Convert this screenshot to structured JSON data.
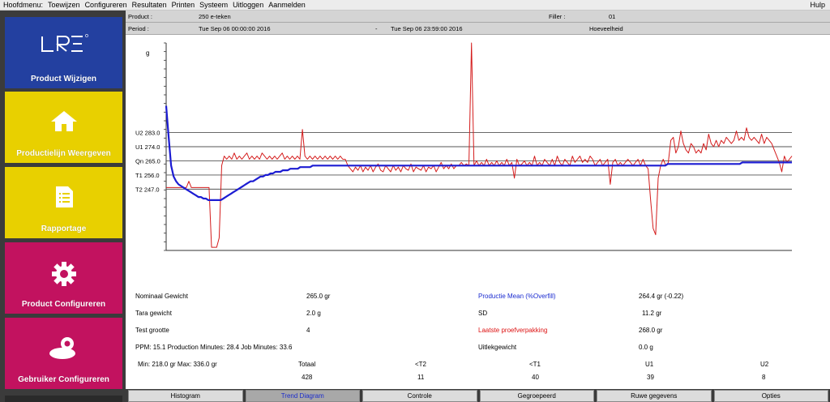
{
  "menu": {
    "items": [
      "Hoofdmenu:",
      "Toewijzen",
      "Configureren",
      "Resultaten",
      "Printen",
      "Systeem",
      "Uitloggen",
      "Aanmelden"
    ],
    "help": "Hulp"
  },
  "sidebar": {
    "logo_text": "LRE",
    "tiles": [
      {
        "label": "Product Wijzigen",
        "icon": "lre-logo",
        "color": "#2340a0"
      },
      {
        "label": "Productielijn Weergeven",
        "icon": "home-icon",
        "color": "#e8d000"
      },
      {
        "label": "Rapportage",
        "icon": "document-icon",
        "color": "#e8d000"
      },
      {
        "label": "Product Configureren",
        "icon": "gear-icon",
        "color": "#c2125f"
      },
      {
        "label": "Gebruiker Configureren",
        "icon": "user-gear-icon",
        "color": "#c2125f"
      }
    ]
  },
  "info": {
    "product_label": "Product :",
    "product_value": "250 e-teken",
    "filler_label": "Filler :",
    "filler_value": "01",
    "period_label": "Period :",
    "period_start": "Tue Sep 06 00:00:00 2016",
    "period_sep": "-",
    "period_end": "Tue Sep 06 23:59:00 2016",
    "quantity_label": "Hoeveelheid"
  },
  "chart_data": {
    "type": "line",
    "ylabel": "g",
    "ylim": [
      208,
      340
    ],
    "reference_lines": [
      {
        "label": "U2 283.0",
        "value": 283.0
      },
      {
        "label": "U1 274.0",
        "value": 274.0
      },
      {
        "label": "Qn 265.0",
        "value": 265.0
      },
      {
        "label": "T1 256.0",
        "value": 256.0
      },
      {
        "label": "T2 247.0",
        "value": 247.0
      }
    ],
    "series": [
      {
        "color": "#d41c1c",
        "values": [
          248,
          248,
          248,
          248,
          248,
          248,
          248,
          248,
          248,
          252,
          248,
          248,
          248,
          248,
          248,
          248,
          248,
          248,
          210,
          210,
          210,
          216,
          262,
          268,
          266,
          268,
          266,
          270,
          266,
          268,
          266,
          268,
          270,
          266,
          268,
          266,
          268,
          266,
          270,
          268,
          266,
          268,
          266,
          268,
          266,
          268,
          270,
          266,
          268,
          266,
          268,
          266,
          268,
          266,
          285,
          268,
          266,
          268,
          266,
          268,
          266,
          268,
          266,
          268,
          266,
          268,
          266,
          268,
          266,
          268,
          266,
          266,
          262,
          260,
          258,
          261,
          259,
          262,
          258,
          261,
          259,
          262,
          258,
          261,
          263,
          259,
          258,
          262,
          260,
          258,
          262,
          259,
          261,
          258,
          262,
          260,
          259,
          263,
          258,
          261,
          260,
          259,
          262,
          258,
          261,
          260,
          262,
          258,
          261,
          264,
          260,
          262,
          260,
          263,
          260,
          262,
          262,
          264,
          262,
          263,
          262,
          340,
          262,
          265,
          262,
          264,
          262,
          266,
          262,
          264,
          262,
          265,
          262,
          264,
          262,
          266,
          262,
          264,
          254,
          266,
          262,
          263,
          265,
          262,
          264,
          262,
          268,
          262,
          264,
          262,
          266,
          264,
          262,
          266,
          262,
          268,
          264,
          262,
          266,
          264,
          262,
          268,
          264,
          266,
          268,
          264,
          266,
          264,
          268,
          266,
          262,
          264,
          266,
          262,
          264,
          266,
          250,
          264,
          266,
          262,
          264,
          262,
          264,
          266,
          264,
          262,
          264,
          266,
          262,
          266,
          262,
          260,
          240,
          222,
          218,
          254,
          262,
          266,
          262,
          264,
          278,
          280,
          270,
          274,
          284,
          276,
          272,
          270,
          276,
          274,
          270,
          272,
          270,
          276,
          272,
          282,
          276,
          274,
          278,
          274,
          278,
          276,
          280,
          278,
          276,
          278,
          284,
          278,
          280,
          278,
          286,
          280,
          278,
          280,
          278,
          276,
          282,
          276,
          280,
          278,
          276,
          272,
          268,
          264,
          258,
          268,
          264,
          266,
          268
        ]
      },
      {
        "color": "#1c1cd2",
        "values": [
          300,
          280,
          262,
          255,
          252,
          250,
          249,
          248,
          247,
          246,
          245,
          244,
          243,
          242,
          242,
          241,
          241,
          240,
          240,
          240,
          240,
          240,
          240,
          241,
          242,
          243,
          244,
          245,
          246,
          247,
          248,
          249,
          250,
          251,
          252,
          252,
          253,
          254,
          255,
          255,
          256,
          256,
          257,
          257,
          258,
          258,
          258,
          259,
          259,
          259,
          260,
          260,
          260,
          260,
          261,
          261,
          261,
          261,
          261,
          262,
          262,
          262,
          262,
          262,
          262,
          262,
          262,
          262,
          262,
          262,
          262,
          262,
          262,
          262,
          262,
          262,
          262,
          262,
          262,
          262,
          262,
          262,
          262,
          262,
          262,
          262,
          262,
          262,
          262,
          262,
          262,
          262,
          262,
          262,
          262,
          262,
          262,
          262,
          262,
          262,
          262,
          262,
          262,
          262,
          262,
          262,
          262,
          262,
          262,
          262,
          262,
          262,
          262,
          262,
          262,
          262,
          262,
          262,
          262,
          262,
          262,
          262,
          262,
          262,
          262,
          262,
          262,
          262,
          262,
          262,
          262,
          262,
          262,
          262,
          262,
          262,
          262,
          262,
          262,
          262,
          262,
          262,
          262,
          262,
          262,
          262,
          262,
          262,
          262,
          262,
          262,
          262,
          262,
          262,
          262,
          262,
          262,
          262,
          262,
          262,
          262,
          262,
          262,
          262,
          262,
          262,
          262,
          262,
          262,
          262,
          262,
          262,
          262,
          262,
          262,
          262,
          262,
          262,
          262,
          262,
          262,
          262,
          262,
          262,
          262,
          262,
          262,
          262,
          262,
          262,
          262,
          262,
          262,
          262,
          262,
          262,
          262,
          262,
          262,
          262,
          262,
          262,
          263,
          263,
          263,
          263,
          263,
          263,
          263,
          263,
          263,
          263,
          263,
          263,
          263,
          263,
          263,
          263,
          263,
          263,
          263,
          263,
          263,
          263,
          263,
          263,
          263,
          263,
          263,
          263,
          263,
          263,
          264,
          264,
          264,
          264,
          264,
          264,
          264,
          264,
          264,
          264,
          264,
          264,
          264,
          264,
          264,
          264,
          264,
          264,
          264,
          264,
          264
        ]
      }
    ]
  },
  "stats": {
    "nominal_label": "Nominaal Gewicht",
    "nominal_value": "265.0 gr",
    "tare_label": "Tara gewicht",
    "tare_value": "2.0 g",
    "sample_label": "Test grootte",
    "sample_value": "4",
    "ppm_text": "PPM: 15.1   Production Minutes: 28.4   Job Minutes: 33.6",
    "mean_label": "Productie Mean (%Overfill)",
    "mean_value": "264.4 gr (-0.22)",
    "sd_label": "SD",
    "sd_value": "11.2 gr",
    "last_label": "Laatste proefverpakking",
    "last_value": "268.0 gr",
    "output_label": "Uitlekgewicht",
    "output_value": "0.0 g",
    "minmax_text": "Min: 218.0 gr Max: 336.0 gr",
    "counts_headers": [
      "Totaal",
      "<T2",
      "<T1",
      "U1",
      "U2"
    ],
    "counts_values": [
      "428",
      "11",
      "40",
      "39",
      "8"
    ]
  },
  "tabs": [
    {
      "label": "Histogram",
      "active": false
    },
    {
      "label": "Trend Diagram",
      "active": true
    },
    {
      "label": "Controle",
      "active": false
    },
    {
      "label": "Gegroepeerd",
      "active": false
    },
    {
      "label": "Ruwe gegevens",
      "active": false
    },
    {
      "label": "Opties",
      "active": false
    }
  ]
}
